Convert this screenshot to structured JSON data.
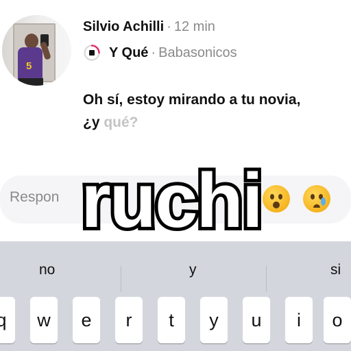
{
  "post": {
    "author": "Silvio Achilli",
    "separator": "·",
    "time": "12 min",
    "song": {
      "title": "Y Qué",
      "separator": "·",
      "artist": "Babasonicos"
    },
    "message_main": "Oh sí, estoy mirando a tu novia,",
    "message_line2_start": "¿y ",
    "message_line2_faded": "qué?"
  },
  "reply": {
    "placeholder": "Respon",
    "emoji_1": "surprised-face",
    "emoji_2": "crying-face"
  },
  "caption": "ruchi",
  "keyboard": {
    "suggestions": [
      "no",
      "y",
      "si"
    ],
    "keys": [
      "q",
      "w",
      "e",
      "r",
      "t",
      "y",
      "u",
      "i",
      "o"
    ]
  },
  "colors": {
    "muted_text": "#8a8a8a",
    "faded_text": "#c4c4c4",
    "keyboard_bg": "#d3d6dc",
    "jersey": "#5b3a8e"
  }
}
